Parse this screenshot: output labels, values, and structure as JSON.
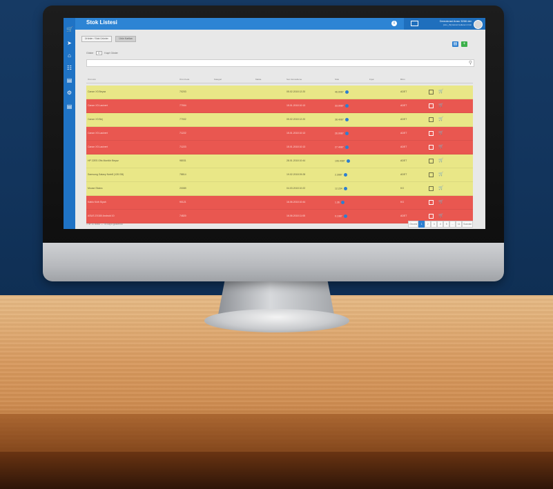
{
  "app": {
    "title": "Stok Listesi"
  },
  "topbar": {
    "user_name": "Demokrasi Arası 3266 der",
    "user_sub": "[ALL_IN] Isimsiz kullanıcı Izmir"
  },
  "tabs": [
    {
      "label": "Ürünler / Stok Ürünler",
      "active": true
    },
    {
      "label": "Ürün Kartları",
      "active": false
    }
  ],
  "toolbar": {
    "show_label": "Göster",
    "show_value": "10",
    "show_suffix": "Kayıt Göster"
  },
  "search": {
    "placeholder": ""
  },
  "table": {
    "columns": [
      "Ürün Adı",
      "Ürün Kodu",
      "Kategori",
      "Marka",
      "Son Güncelleme",
      "Stok",
      "Fiyat",
      "Birim"
    ],
    "rows": [
      {
        "name": "Canon X3 Beyaz",
        "code": "70203",
        "date": "05.02.2018 12:20",
        "stock": "46.0087",
        "unit": "ADET",
        "status": "yellow"
      },
      {
        "name": "Canon X3 Lacivert",
        "code": "77004",
        "date": "15.01.2018 10:13",
        "stock": "33.0087",
        "unit": "ADET",
        "status": "red"
      },
      {
        "name": "Canon X3 Bej",
        "code": "77002",
        "date": "05.02.2018 12:20",
        "stock": "38.4087",
        "unit": "ADET",
        "status": "yellow"
      },
      {
        "name": "Canon X3 Lacivert",
        "code": "71222",
        "date": "15.01.2018 10:13",
        "stock": "26.0087",
        "unit": "ADET",
        "status": "red"
      },
      {
        "name": "Canon X3 Lacivert",
        "code": "71223",
        "date": "15.01.2018 10:13",
        "stock": "27.4087",
        "unit": "ADET",
        "status": "red"
      },
      {
        "name": "HP 22ES Ofis Monitör Beyaz",
        "code": "98031",
        "date": "28.01.2018 10:44",
        "stock": "106.4087",
        "unit": "ADET",
        "status": "yellow"
      },
      {
        "name": "Samsung Galaxy Note8 (128 GB)",
        "code": "78814",
        "date": "19.02.2018 09:28",
        "stock": "2.3087",
        "unit": "ADET",
        "status": "yellow"
      },
      {
        "name": "Mouse Ekstra",
        "code": "20089",
        "date": "04.03.2018 10:22",
        "stock": "12.234",
        "unit": "KG",
        "status": "yellow"
      },
      {
        "name": "Kablo Kılıfı Siyah",
        "code": "90121",
        "date": "16.06.2018 10:44",
        "stock": "1.36",
        "unit": "KG",
        "status": "red"
      },
      {
        "name": "ASUS ZX180 Android 10",
        "code": "74820",
        "date": "16.06.2018 11:05",
        "stock": "0.1087",
        "unit": "ADET",
        "status": "red"
      }
    ]
  },
  "footer": {
    "info": "1 ile 10 arası — 78 kayıt gösterildi"
  },
  "pagination": {
    "prev": "Önceki",
    "pages": [
      "1",
      "2",
      "3",
      "4",
      "5",
      "...",
      "11"
    ],
    "next": "Sonraki"
  },
  "colors": {
    "row_yellow": "#e9e787",
    "row_red": "#e95750",
    "brand_blue": "#2d84d4",
    "sidebar_blue": "#1f73c5"
  },
  "icons": {
    "sidebar": [
      "cart-icon",
      "arrow-right-icon",
      "home-icon",
      "bank-icon",
      "inbox-icon",
      "gear-icon",
      "document-icon"
    ],
    "row_actions": [
      "document-icon",
      "cart-icon"
    ]
  }
}
